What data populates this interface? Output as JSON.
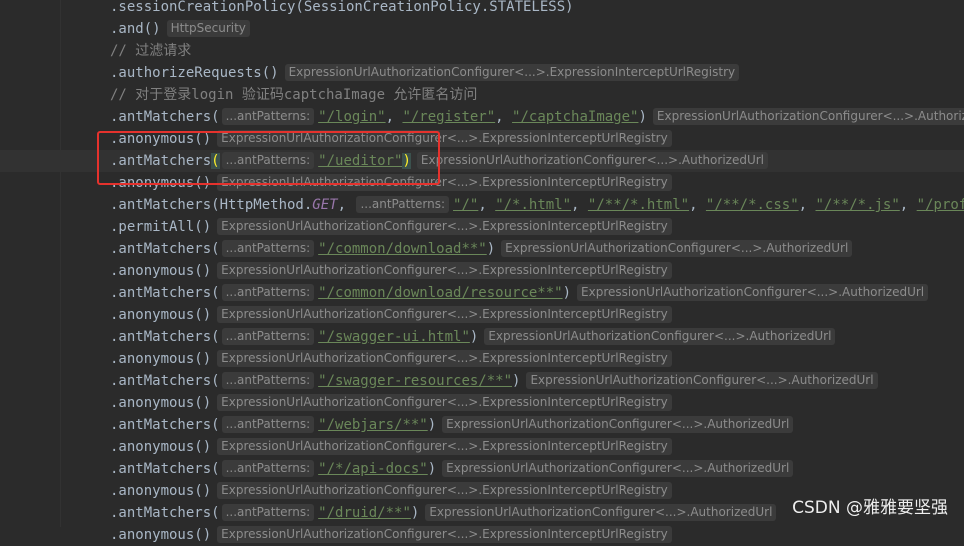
{
  "hints": {
    "ant_patterns": "antPatterns:",
    "http_security": "HttpSecurity",
    "registry": "ExpressionUrlAuthorizationConfigurer<...>.ExpressionInterceptUrlRegistry",
    "authorized_url": "ExpressionUrlAuthorizationConfigurer<...>.AuthorizedUrl"
  },
  "lines": [
    {
      "parts": [
        {
          "t": "code",
          "v": ".sessionCreationPolicy(SessionCreationPolicy.STATELESS)"
        }
      ]
    },
    {
      "parts": [
        {
          "t": "code",
          "v": ".and()"
        },
        {
          "t": "hint",
          "v": "HttpSecurity"
        }
      ]
    },
    {
      "parts": [
        {
          "t": "comment",
          "v": "// 过滤请求"
        }
      ]
    },
    {
      "parts": [
        {
          "t": "code",
          "v": ".authorizeRequests()"
        },
        {
          "t": "hint",
          "v": "ExpressionUrlAuthorizationConfigurer<...>.ExpressionInterceptUrlRegistry"
        }
      ]
    },
    {
      "parts": [
        {
          "t": "comment",
          "v": "// 对于登录login 验证码captchaImage 允许匿名访问"
        }
      ]
    },
    {
      "parts": [
        {
          "t": "code",
          "v": ".antMatchers("
        },
        {
          "t": "param",
          "v": "...antPatterns:"
        },
        {
          "t": "str",
          "v": "\"/login\""
        },
        {
          "t": "code",
          "v": ", "
        },
        {
          "t": "str",
          "v": "\"/register\""
        },
        {
          "t": "code",
          "v": ", "
        },
        {
          "t": "str",
          "v": "\"/captchaImage\""
        },
        {
          "t": "code",
          "v": ")"
        },
        {
          "t": "hint",
          "v": "ExpressionUrlAuthorizationConfigurer<...>.AuthorizedUrl"
        }
      ]
    },
    {
      "parts": [
        {
          "t": "code",
          "v": ".anonymous()"
        },
        {
          "t": "hint",
          "v": "ExpressionUrlAuthorizationConfigurer<...>.ExpressionInterceptUrlRegistry"
        }
      ]
    },
    {
      "current": true,
      "parts": [
        {
          "t": "code",
          "v": ".antMatchers"
        },
        {
          "t": "hl",
          "v": "("
        },
        {
          "t": "param",
          "v": "...antPatterns:"
        },
        {
          "t": "str",
          "v": "\"/ueditor\""
        },
        {
          "t": "hl",
          "v": ")"
        },
        {
          "t": "hint",
          "v": "ExpressionUrlAuthorizationConfigurer<...>.AuthorizedUrl"
        }
      ]
    },
    {
      "parts": [
        {
          "t": "code",
          "v": ".anonymous()"
        },
        {
          "t": "hint",
          "v": "ExpressionUrlAuthorizationConfigurer<...>.ExpressionInterceptUrlRegistry"
        }
      ]
    },
    {
      "parts": [
        {
          "t": "code",
          "v": ".antMatchers(HttpMethod."
        },
        {
          "t": "enum",
          "v": "GET"
        },
        {
          "t": "code",
          "v": ", "
        },
        {
          "t": "param",
          "v": "...antPatterns:"
        },
        {
          "t": "str",
          "v": "\"/\""
        },
        {
          "t": "code",
          "v": ", "
        },
        {
          "t": "str",
          "v": "\"/*.html\""
        },
        {
          "t": "code",
          "v": ", "
        },
        {
          "t": "str",
          "v": "\"/**/*.html\""
        },
        {
          "t": "code",
          "v": ", "
        },
        {
          "t": "str",
          "v": "\"/**/*.css\""
        },
        {
          "t": "code",
          "v": ", "
        },
        {
          "t": "str",
          "v": "\"/**/*.js\""
        },
        {
          "t": "code",
          "v": ", "
        },
        {
          "t": "str",
          "v": "\"/profile/**\""
        }
      ]
    },
    {
      "parts": [
        {
          "t": "code",
          "v": ".permitAll()"
        },
        {
          "t": "hint",
          "v": "ExpressionUrlAuthorizationConfigurer<...>.ExpressionInterceptUrlRegistry"
        }
      ]
    },
    {
      "parts": [
        {
          "t": "code",
          "v": ".antMatchers("
        },
        {
          "t": "param",
          "v": "...antPatterns:"
        },
        {
          "t": "str",
          "v": "\"/common/download**\""
        },
        {
          "t": "code",
          "v": ")"
        },
        {
          "t": "hint",
          "v": "ExpressionUrlAuthorizationConfigurer<...>.AuthorizedUrl"
        }
      ]
    },
    {
      "parts": [
        {
          "t": "code",
          "v": ".anonymous()"
        },
        {
          "t": "hint",
          "v": "ExpressionUrlAuthorizationConfigurer<...>.ExpressionInterceptUrlRegistry"
        }
      ]
    },
    {
      "parts": [
        {
          "t": "code",
          "v": ".antMatchers("
        },
        {
          "t": "param",
          "v": "...antPatterns:"
        },
        {
          "t": "str",
          "v": "\"/common/download/resource**\""
        },
        {
          "t": "code",
          "v": ")"
        },
        {
          "t": "hint",
          "v": "ExpressionUrlAuthorizationConfigurer<...>.AuthorizedUrl"
        }
      ]
    },
    {
      "parts": [
        {
          "t": "code",
          "v": ".anonymous()"
        },
        {
          "t": "hint",
          "v": "ExpressionUrlAuthorizationConfigurer<...>.ExpressionInterceptUrlRegistry"
        }
      ]
    },
    {
      "parts": [
        {
          "t": "code",
          "v": ".antMatchers("
        },
        {
          "t": "param",
          "v": "...antPatterns:"
        },
        {
          "t": "str",
          "v": "\"/swagger-ui.html\""
        },
        {
          "t": "code",
          "v": ")"
        },
        {
          "t": "hint",
          "v": "ExpressionUrlAuthorizationConfigurer<...>.AuthorizedUrl"
        }
      ]
    },
    {
      "parts": [
        {
          "t": "code",
          "v": ".anonymous()"
        },
        {
          "t": "hint",
          "v": "ExpressionUrlAuthorizationConfigurer<...>.ExpressionInterceptUrlRegistry"
        }
      ]
    },
    {
      "parts": [
        {
          "t": "code",
          "v": ".antMatchers("
        },
        {
          "t": "param",
          "v": "...antPatterns:"
        },
        {
          "t": "str",
          "v": "\"/swagger-resources/**\""
        },
        {
          "t": "code",
          "v": ")"
        },
        {
          "t": "hint",
          "v": "ExpressionUrlAuthorizationConfigurer<...>.AuthorizedUrl"
        }
      ]
    },
    {
      "parts": [
        {
          "t": "code",
          "v": ".anonymous()"
        },
        {
          "t": "hint",
          "v": "ExpressionUrlAuthorizationConfigurer<...>.ExpressionInterceptUrlRegistry"
        }
      ]
    },
    {
      "parts": [
        {
          "t": "code",
          "v": ".antMatchers("
        },
        {
          "t": "param",
          "v": "...antPatterns:"
        },
        {
          "t": "str",
          "v": "\"/webjars/**\""
        },
        {
          "t": "code",
          "v": ")"
        },
        {
          "t": "hint",
          "v": "ExpressionUrlAuthorizationConfigurer<...>.AuthorizedUrl"
        }
      ]
    },
    {
      "parts": [
        {
          "t": "code",
          "v": ".anonymous()"
        },
        {
          "t": "hint",
          "v": "ExpressionUrlAuthorizationConfigurer<...>.ExpressionInterceptUrlRegistry"
        }
      ]
    },
    {
      "parts": [
        {
          "t": "code",
          "v": ".antMatchers("
        },
        {
          "t": "param",
          "v": "...antPatterns:"
        },
        {
          "t": "str",
          "v": "\"/*/api-docs\""
        },
        {
          "t": "code",
          "v": ")"
        },
        {
          "t": "hint",
          "v": "ExpressionUrlAuthorizationConfigurer<...>.AuthorizedUrl"
        }
      ]
    },
    {
      "parts": [
        {
          "t": "code",
          "v": ".anonymous()"
        },
        {
          "t": "hint",
          "v": "ExpressionUrlAuthorizationConfigurer<...>.ExpressionInterceptUrlRegistry"
        }
      ]
    },
    {
      "parts": [
        {
          "t": "code",
          "v": ".antMatchers("
        },
        {
          "t": "param",
          "v": "...antPatterns:"
        },
        {
          "t": "str",
          "v": "\"/druid/**\""
        },
        {
          "t": "code",
          "v": ")"
        },
        {
          "t": "hint",
          "v": "ExpressionUrlAuthorizationConfigurer<...>.AuthorizedUrl"
        }
      ]
    },
    {
      "parts": [
        {
          "t": "code",
          "v": ".anonymous()"
        },
        {
          "t": "hint",
          "v": "ExpressionUrlAuthorizationConfigurer<...>.ExpressionInterceptUrlRegistry"
        }
      ]
    }
  ],
  "watermark": "CSDN @雅雅要坚强",
  "colors": {
    "background": "#2b2b2b",
    "code": "#a9b7c6",
    "comment": "#808080",
    "string": "#6a8759",
    "enum": "#9876aa",
    "brace_highlight": "#ffef28",
    "annotation_box": "#e5322d"
  }
}
